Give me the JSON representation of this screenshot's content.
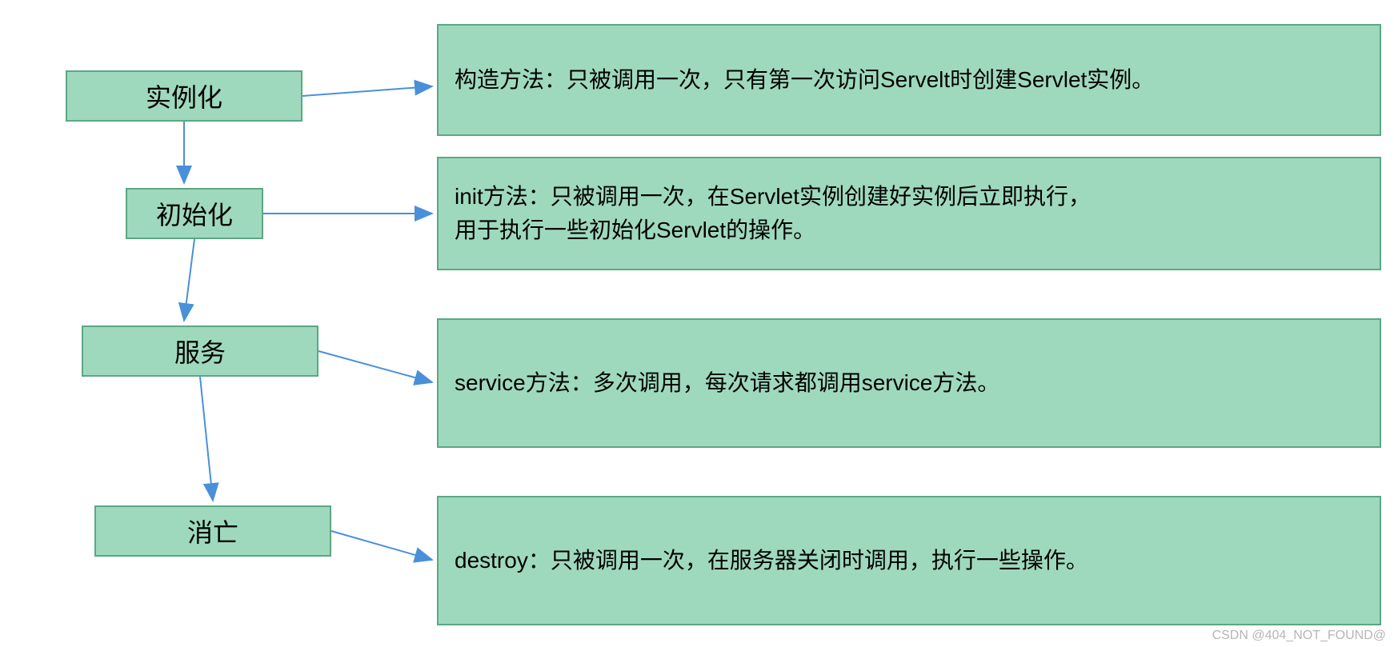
{
  "stages": [
    {
      "label": "实例化"
    },
    {
      "label": "初始化"
    },
    {
      "label": "服务"
    },
    {
      "label": "消亡"
    }
  ],
  "descriptions": [
    {
      "text": "构造方法：只被调用一次，只有第一次访问Servelt时创建Servlet实例。"
    },
    {
      "text": "init方法：只被调用一次，在Servlet实例创建好实例后立即执行，\n用于执行一些初始化Servlet的操作。"
    },
    {
      "text": "service方法：多次调用，每次请求都调用service方法。"
    },
    {
      "text": "destroy：只被调用一次，在服务器关闭时调用，执行一些操作。"
    }
  ],
  "watermark": "CSDN @404_NOT_FOUND@",
  "colors": {
    "boxFill": "#9fd9bd",
    "boxBorder": "#5aa884",
    "arrow": "#4a90d9"
  }
}
